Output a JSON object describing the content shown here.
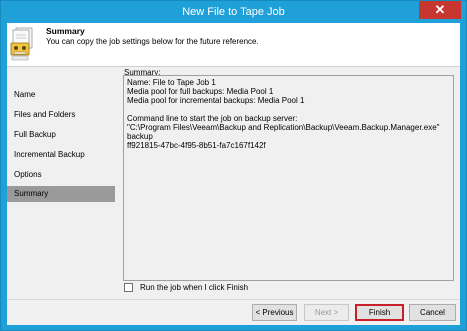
{
  "window": {
    "title": "New File to Tape Job",
    "close_glyph": "✕"
  },
  "header": {
    "title": "Summary",
    "description": "You can copy the job settings below for the future reference.",
    "icon": "tape-job-icon"
  },
  "sidebar": {
    "items": [
      {
        "label": "Name",
        "selected": false
      },
      {
        "label": "Files and Folders",
        "selected": false
      },
      {
        "label": "Full Backup",
        "selected": false
      },
      {
        "label": "Incremental Backup",
        "selected": false
      },
      {
        "label": "Options",
        "selected": false
      },
      {
        "label": "Summary",
        "selected": true
      }
    ]
  },
  "main": {
    "summary_label": "Summary:",
    "summary_text": "Name: File to Tape Job 1\nMedia pool for full backups: Media Pool 1\nMedia pool for incremental backups: Media Pool 1\n\nCommand line to start the job on backup server:\n\"C:\\Program Files\\Veeam\\Backup and Replication\\Backup\\Veeam.Backup.Manager.exe\" backup\nff921815-47bc-4f95-8b51-fa7c167f142f"
  },
  "run_checkbox": {
    "label": "Run the job when I click Finish",
    "checked": false
  },
  "buttons": {
    "previous": "< Previous",
    "next": "Next >",
    "finish": "Finish",
    "cancel": "Cancel"
  },
  "colors": {
    "titlebar": "#1fa0d8",
    "close": "#c7372f",
    "selected_nav": "#9a9a9a",
    "finish_border": "#c8202a"
  }
}
